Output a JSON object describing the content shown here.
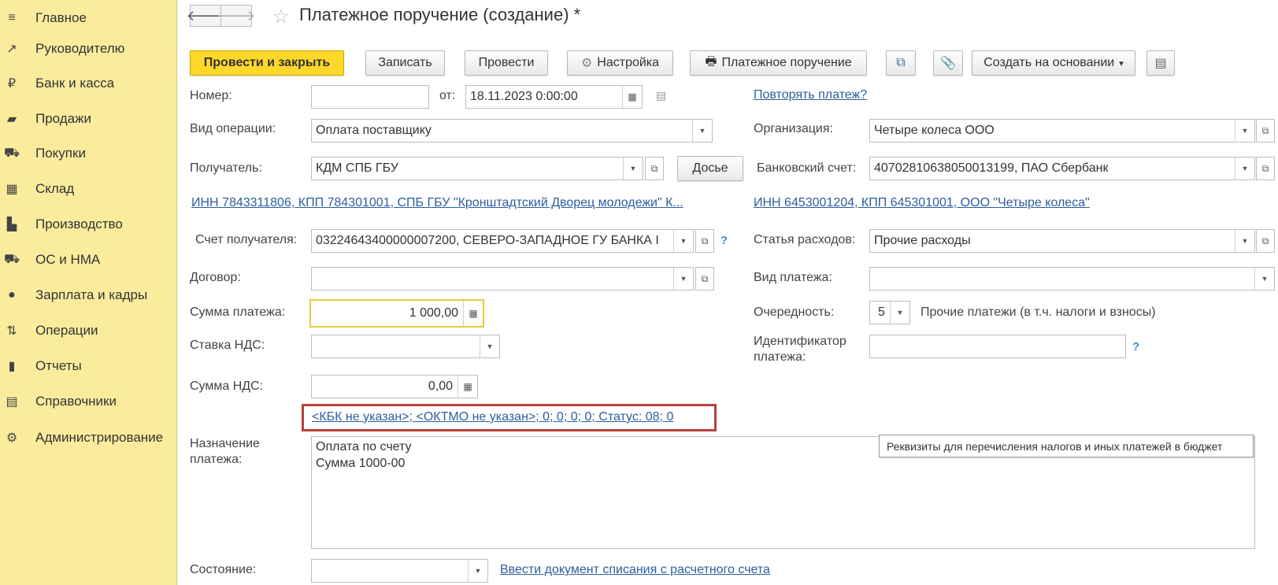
{
  "sidebar": {
    "items": [
      {
        "label": "Главное",
        "icon": "menu-lines-icon",
        "glyph": "≡"
      },
      {
        "label": "Руководителю",
        "icon": "trend-chart-icon",
        "glyph": "↗"
      },
      {
        "label": "Банк и касса",
        "icon": "ruble-coin-icon",
        "glyph": "₽"
      },
      {
        "label": "Продажи",
        "icon": "shopping-bag-icon",
        "glyph": "▰"
      },
      {
        "label": "Покупки",
        "icon": "shopping-cart-icon",
        "glyph": "⛟"
      },
      {
        "label": "Склад",
        "icon": "warehouse-grid-icon",
        "glyph": "▦"
      },
      {
        "label": "Производство",
        "icon": "factory-icon",
        "glyph": "▙"
      },
      {
        "label": "ОС и НМА",
        "icon": "truck-icon",
        "glyph": "⛟"
      },
      {
        "label": "Зарплата и кадры",
        "icon": "person-icon",
        "glyph": "●"
      },
      {
        "label": "Операции",
        "icon": "debit-credit-icon",
        "glyph": "⇅"
      },
      {
        "label": "Отчеты",
        "icon": "bar-chart-icon",
        "glyph": "▮"
      },
      {
        "label": "Справочники",
        "icon": "books-icon",
        "glyph": "▤"
      },
      {
        "label": "Администрирование",
        "icon": "gear-icon",
        "glyph": "⚙"
      }
    ]
  },
  "header": {
    "back": "🡐",
    "forward": "🡒",
    "star": "☆",
    "title": "Платежное поручение (создание) *"
  },
  "toolbar": {
    "post_close": "Провести и закрыть",
    "save": "Записать",
    "post": "Провести",
    "settings": "Настройка",
    "settings_glyph": "⚙",
    "print": "Платежное поручение",
    "print_glyph": "🖶",
    "structure_glyph": "⧉",
    "attach_glyph": "📎",
    "create_based": "Создать на основании",
    "create_based_arrow": "▾",
    "more_glyph": "▤"
  },
  "form": {
    "number_label": "Номер:",
    "number_value": "",
    "from_label": "от:",
    "date_value": "18.11.2023  0:00:00",
    "repeat_link": "Повторять платеж?",
    "op_type_label": "Вид операции:",
    "op_type_value": "Оплата поставщику",
    "org_label": "Организация:",
    "org_value": "Четыре колеса ООО",
    "recipient_label": "Получатель:",
    "recipient_value": "КДМ СПБ ГБУ",
    "dossier": "Досье",
    "bank_account_label": "Банковский счет:",
    "bank_account_value": "40702810638050013199, ПАО Сбербанк",
    "recipient_inn_link": "ИНН 7843311806, КПП 784301001, СПБ ГБУ \"Кронштадтский Дворец молодежи\" К...",
    "org_inn_link": "ИНН 6453001204, КПП 645301001, ООО \"Четыре колеса\"",
    "recipient_account_label": "Счет получателя:",
    "recipient_account_value": "03224643400000007200, СЕВЕРО-ЗАПАДНОЕ ГУ БАНКА I",
    "help": "?",
    "expense_label": "Статья расходов:",
    "expense_value": "Прочие расходы",
    "contract_label": "Договор:",
    "contract_value": "",
    "payment_type_label": "Вид платежа:",
    "payment_type_value": "",
    "amount_label": "Сумма платежа:",
    "amount_value": "1 000,00",
    "priority_label": "Очередность:",
    "priority_value": "5",
    "priority_desc": "Прочие платежи (в т.ч. налоги и взносы)",
    "vat_rate_label": "Ставка НДС:",
    "vat_rate_value": "",
    "payment_id_label_1": "Идентификатор",
    "payment_id_label_2": "платежа:",
    "payment_id_value": "",
    "vat_amount_label": "Сумма НДС:",
    "vat_amount_value": "0,00",
    "budget_link": "<КБК не указан>; <ОКТМО не указан>; 0; 0; 0; 0; Статус: 08; 0",
    "purpose_label_1": "Назначение",
    "purpose_label_2": "платежа:",
    "purpose_line_1": "Оплата по счету",
    "purpose_line_2": "Сумма 1000-00",
    "tooltip": "Реквизиты для перечисления налогов и иных платежей в бюджет",
    "status_label": "Состояние:",
    "status_value": "",
    "writeoff_link": "Ввести документ списания с расчетного счета"
  },
  "colors": {
    "sidebar_bg": "#fbec9d",
    "primary_button": "#ffd82a",
    "link": "#2b5f9e",
    "highlight_box": "#b5413c",
    "focus_border": "#e9c93a"
  }
}
